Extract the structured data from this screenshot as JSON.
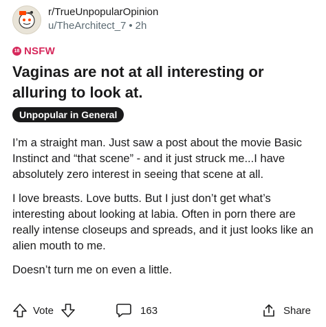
{
  "header": {
    "subreddit": "r/TrueUnpopularOpinion",
    "username": "u/TheArchitect_7",
    "separator": "•",
    "time": "2h"
  },
  "nsfw": {
    "age": "18",
    "label": "NSFW"
  },
  "post": {
    "title": "Vaginas are not at all interesting or alluring to look at.",
    "flair": "Unpopular in General",
    "paragraphs": [
      "I’m a straight man. Just saw a post about the movie Basic Instinct and “that scene” - and it just struck me...I have absolutely zero interest in seeing that scene at all.",
      "I love breasts. Love butts. But I just don’t get what’s interesting about looking at labia. Often in porn there are really intense closeups and spreads, and it just looks like an alien mouth to me.",
      "Doesn’t turn me on even a little."
    ]
  },
  "actions": {
    "vote_label": "Vote",
    "comment_count": "163",
    "share_label": "Share"
  },
  "icons": {
    "avatar": "subreddit-avatar-icon",
    "upvote": "upvote-arrow-icon",
    "downvote": "downvote-arrow-icon",
    "comment": "comment-bubble-icon",
    "share": "share-icon"
  },
  "colors": {
    "nsfw": "#d6285b",
    "flair_bg": "#1a1a1b",
    "meta_text": "#5c6b73"
  }
}
